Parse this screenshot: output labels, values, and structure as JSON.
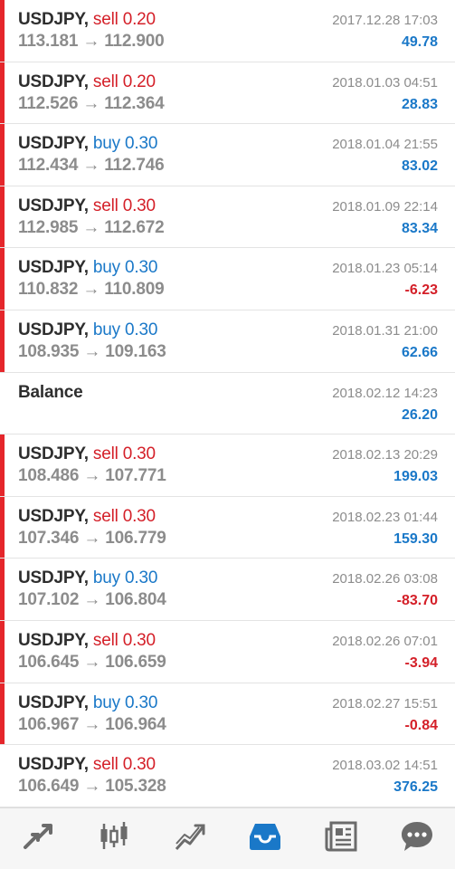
{
  "arrow": "→",
  "colors": {
    "sell": "#d41f28",
    "buy": "#1a78c8",
    "profit": "#1a78c8",
    "loss": "#d41f28",
    "stripe": "#e5262b",
    "active_tab": "#1a78c8",
    "inactive_tab": "#6b6b6b"
  },
  "deals": [
    {
      "symbol": "USDJPY,",
      "side": "sell",
      "volume": "0.20",
      "open": "113.181",
      "close": "112.900",
      "datetime": "2017.12.28 17:03",
      "profit": "49.78",
      "stripe": true
    },
    {
      "symbol": "USDJPY,",
      "side": "sell",
      "volume": "0.20",
      "open": "112.526",
      "close": "112.364",
      "datetime": "2018.01.03 04:51",
      "profit": "28.83",
      "stripe": true
    },
    {
      "symbol": "USDJPY,",
      "side": "buy",
      "volume": "0.30",
      "open": "112.434",
      "close": "112.746",
      "datetime": "2018.01.04 21:55",
      "profit": "83.02",
      "stripe": true
    },
    {
      "symbol": "USDJPY,",
      "side": "sell",
      "volume": "0.30",
      "open": "112.985",
      "close": "112.672",
      "datetime": "2018.01.09 22:14",
      "profit": "83.34",
      "stripe": true
    },
    {
      "symbol": "USDJPY,",
      "side": "buy",
      "volume": "0.30",
      "open": "110.832",
      "close": "110.809",
      "datetime": "2018.01.23 05:14",
      "profit": "-6.23",
      "stripe": true
    },
    {
      "symbol": "USDJPY,",
      "side": "buy",
      "volume": "0.30",
      "open": "108.935",
      "close": "109.163",
      "datetime": "2018.01.31 21:00",
      "profit": "62.66",
      "stripe": true
    },
    {
      "balance": true,
      "label": "Balance",
      "datetime": "2018.02.12 14:23",
      "profit": "26.20",
      "stripe": false
    },
    {
      "symbol": "USDJPY,",
      "side": "sell",
      "volume": "0.30",
      "open": "108.486",
      "close": "107.771",
      "datetime": "2018.02.13 20:29",
      "profit": "199.03",
      "stripe": true
    },
    {
      "symbol": "USDJPY,",
      "side": "sell",
      "volume": "0.30",
      "open": "107.346",
      "close": "106.779",
      "datetime": "2018.02.23 01:44",
      "profit": "159.30",
      "stripe": true
    },
    {
      "symbol": "USDJPY,",
      "side": "buy",
      "volume": "0.30",
      "open": "107.102",
      "close": "106.804",
      "datetime": "2018.02.26 03:08",
      "profit": "-83.70",
      "stripe": true
    },
    {
      "symbol": "USDJPY,",
      "side": "sell",
      "volume": "0.30",
      "open": "106.645",
      "close": "106.659",
      "datetime": "2018.02.26 07:01",
      "profit": "-3.94",
      "stripe": true
    },
    {
      "symbol": "USDJPY,",
      "side": "buy",
      "volume": "0.30",
      "open": "106.967",
      "close": "106.964",
      "datetime": "2018.02.27 15:51",
      "profit": "-0.84",
      "stripe": true
    },
    {
      "symbol": "USDJPY,",
      "side": "sell",
      "volume": "0.30",
      "open": "106.649",
      "close": "105.328",
      "datetime": "2018.03.02 14:51",
      "profit": "376.25",
      "stripe": false
    }
  ],
  "tabs": [
    {
      "id": "quotes",
      "icon": "quotes-arrows-icon",
      "active": false
    },
    {
      "id": "chart",
      "icon": "candlestick-chart-icon",
      "active": false
    },
    {
      "id": "trade",
      "icon": "trade-trend-icon",
      "active": false
    },
    {
      "id": "history",
      "icon": "history-inbox-icon",
      "active": true
    },
    {
      "id": "news",
      "icon": "news-icon",
      "active": false
    },
    {
      "id": "messages",
      "icon": "chat-bubble-icon",
      "active": false
    }
  ]
}
